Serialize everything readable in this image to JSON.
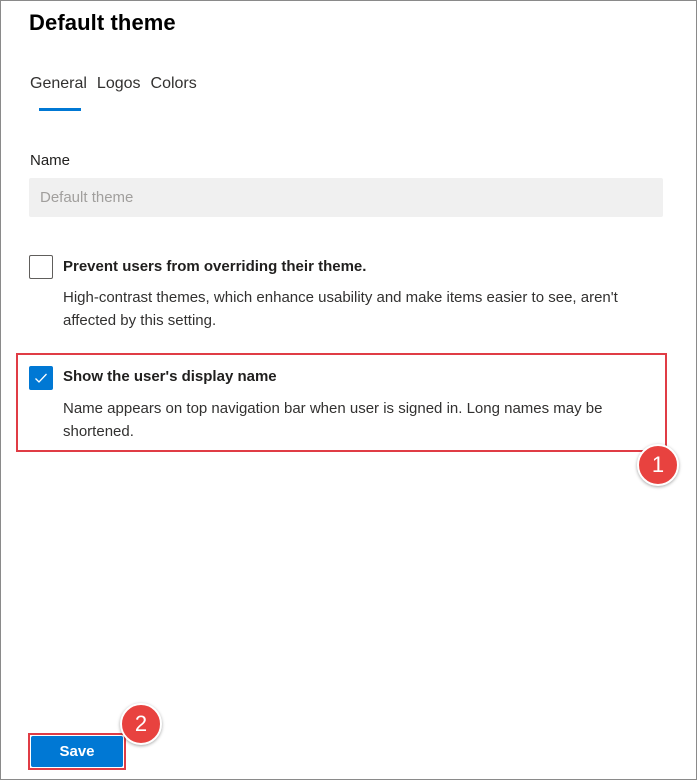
{
  "page": {
    "title": "Default theme"
  },
  "tabs": [
    {
      "label": "General",
      "active": true
    },
    {
      "label": "Logos",
      "active": false
    },
    {
      "label": "Colors",
      "active": false
    }
  ],
  "name_field": {
    "label": "Name",
    "placeholder": "Default theme",
    "value": ""
  },
  "options": [
    {
      "title": "Prevent users from overriding their theme.",
      "description": "High-contrast themes, which enhance usability and make items easier to see, aren't affected by this setting.",
      "checked": false
    },
    {
      "title": "Show the user's display name",
      "description": "Name appears on top navigation bar when user is signed in. Long names may be shortened.",
      "checked": true
    }
  ],
  "save_label": "Save",
  "callouts": {
    "first": "1",
    "second": "2"
  },
  "colors": {
    "accent": "#0078d4",
    "callout": "#e03c45",
    "input_bg": "#f0f0f0"
  }
}
